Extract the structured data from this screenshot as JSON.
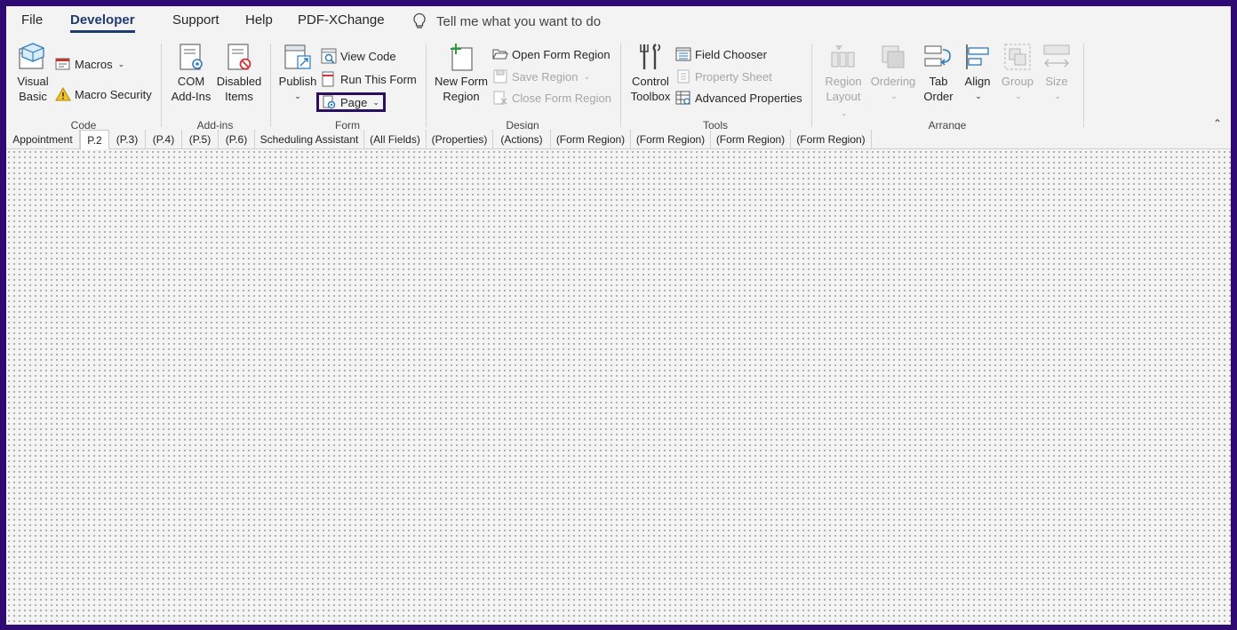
{
  "menu": {
    "file": "File",
    "developer": "Developer",
    "support": "Support",
    "help": "Help",
    "pdfxchange": "PDF-XChange",
    "search_placeholder": "Tell me what you want to do"
  },
  "ribbon": {
    "code": {
      "label": "Code",
      "visual_basic": [
        "Visual",
        "Basic"
      ],
      "macros": "Macros",
      "macro_security": "Macro Security"
    },
    "addins": {
      "label": "Add-ins",
      "com": [
        "COM",
        "Add-Ins"
      ],
      "disabled": [
        "Disabled",
        "Items"
      ]
    },
    "form": {
      "label": "Form",
      "publish": "Publish",
      "view_code": "View Code",
      "run_this_form": "Run This Form",
      "page": "Page"
    },
    "design": {
      "label": "Design",
      "new_form_region": [
        "New Form",
        "Region"
      ],
      "open_form_region": "Open Form Region",
      "save_region": "Save Region",
      "close_form_region": "Close Form Region"
    },
    "tools": {
      "label": "Tools",
      "control_toolbox": [
        "Control",
        "Toolbox"
      ],
      "field_chooser": "Field Chooser",
      "property_sheet": "Property Sheet",
      "advanced_properties": "Advanced Properties"
    },
    "arrange": {
      "label": "Arrange",
      "region_layout": [
        "Region",
        "Layout"
      ],
      "ordering": "Ordering",
      "tab_order": [
        "Tab",
        "Order"
      ],
      "align": "Align",
      "group": "Group",
      "size": "Size"
    }
  },
  "form_tabs": [
    "Appointment",
    "P.2",
    "(P.3)",
    "(P.4)",
    "(P.5)",
    "(P.6)",
    "Scheduling Assistant",
    "(All Fields)",
    "(Properties)",
    "(Actions)",
    "(Form Region)",
    "(Form Region)",
    "(Form Region)",
    "(Form Region)"
  ],
  "active_tab": "P.2",
  "colors": {
    "frame": "#2e0a72",
    "accent": "#1f3b71",
    "highlight_border": "#2b0f5e"
  }
}
